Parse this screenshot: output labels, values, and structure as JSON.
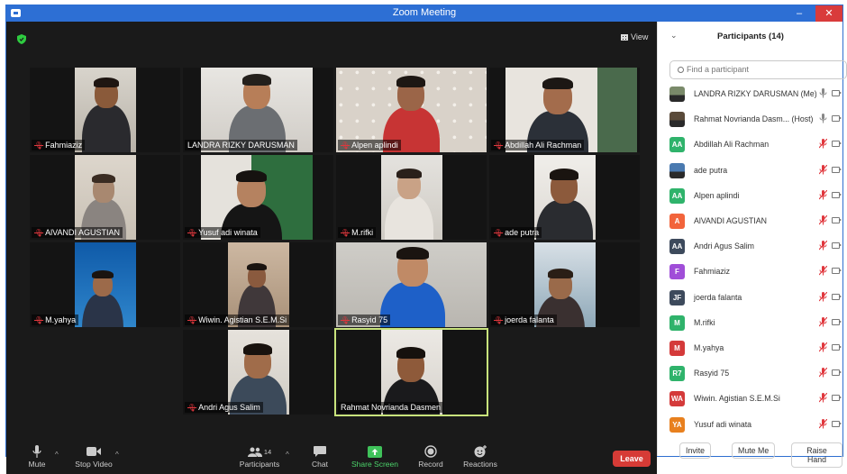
{
  "window": {
    "title": "Zoom Meeting",
    "minimize": "–",
    "restore": "❐",
    "close": "✕"
  },
  "stage": {
    "view_label": "View"
  },
  "tiles": [
    {
      "name": "Fahmiaziz",
      "muted": true
    },
    {
      "name": "LANDRA RIZKY DARUSMAN",
      "muted": false
    },
    {
      "name": "Alpen aplindi",
      "muted": true
    },
    {
      "name": "Abdillah Ali Rachman",
      "muted": true
    },
    {
      "name": "AlVANDI AGUSTIAN",
      "muted": true
    },
    {
      "name": "Yusuf adi winata",
      "muted": true
    },
    {
      "name": "M.rifki",
      "muted": true
    },
    {
      "name": "ade putra",
      "muted": true
    },
    {
      "name": "M.yahya",
      "muted": true
    },
    {
      "name": "Wiwin. Agistian S.E.M.Si",
      "muted": true
    },
    {
      "name": "Rasyid 75",
      "muted": true
    },
    {
      "name": "joerda falanta",
      "muted": true
    },
    {
      "name": "Andri Agus Salim",
      "muted": true
    },
    {
      "name": "Rahmat Novrianda Dasmen",
      "muted": false,
      "speaking": true
    }
  ],
  "toolbar": {
    "mute": "Mute",
    "stop_video": "Stop Video",
    "participants": "Participants",
    "participants_count": "14",
    "chat": "Chat",
    "share_screen": "Share Screen",
    "record": "Record",
    "reactions": "Reactions",
    "leave": "Leave"
  },
  "panel": {
    "title": "Participants (14)",
    "search_placeholder": "Find a participant",
    "participants": [
      {
        "name": "LANDRA RIZKY DARUSMAN (Me)",
        "avatar": "",
        "color": "#7a8a6a",
        "photo": true,
        "muted": false
      },
      {
        "name": "Rahmat Novrianda Dasm... (Host)",
        "avatar": "",
        "color": "#5a4a3a",
        "photo": true,
        "muted": false
      },
      {
        "name": "Abdillah Ali Rachman",
        "avatar": "AA",
        "color": "#2fb36b",
        "muted": true
      },
      {
        "name": "ade putra",
        "avatar": "",
        "color": "#4a7ab0",
        "photo": true,
        "muted": true
      },
      {
        "name": "Alpen aplindi",
        "avatar": "AA",
        "color": "#2fb36b",
        "muted": true
      },
      {
        "name": "AlVANDI AGUSTIAN",
        "avatar": "A",
        "color": "#f2643b",
        "muted": true
      },
      {
        "name": "Andri Agus Salim",
        "avatar": "AA",
        "color": "#3d4a5c",
        "muted": true
      },
      {
        "name": "Fahmiaziz",
        "avatar": "F",
        "color": "#a04ed8",
        "muted": true
      },
      {
        "name": "joerda falanta",
        "avatar": "JF",
        "color": "#3d4a5c",
        "muted": true
      },
      {
        "name": "M.rifki",
        "avatar": "M",
        "color": "#2fb36b",
        "muted": true
      },
      {
        "name": "M.yahya",
        "avatar": "M",
        "color": "#d43a3a",
        "muted": true
      },
      {
        "name": "Rasyid 75",
        "avatar": "R7",
        "color": "#2fb36b",
        "muted": true
      },
      {
        "name": "Wiwin. Agistian S.E.M.Si",
        "avatar": "WA",
        "color": "#d43a3a",
        "muted": true
      },
      {
        "name": "Yusuf adi winata",
        "avatar": "YA",
        "color": "#e8801e",
        "muted": true
      }
    ],
    "invite": "Invite",
    "mute_me": "Mute Me",
    "raise_hand": "Raise Hand"
  }
}
